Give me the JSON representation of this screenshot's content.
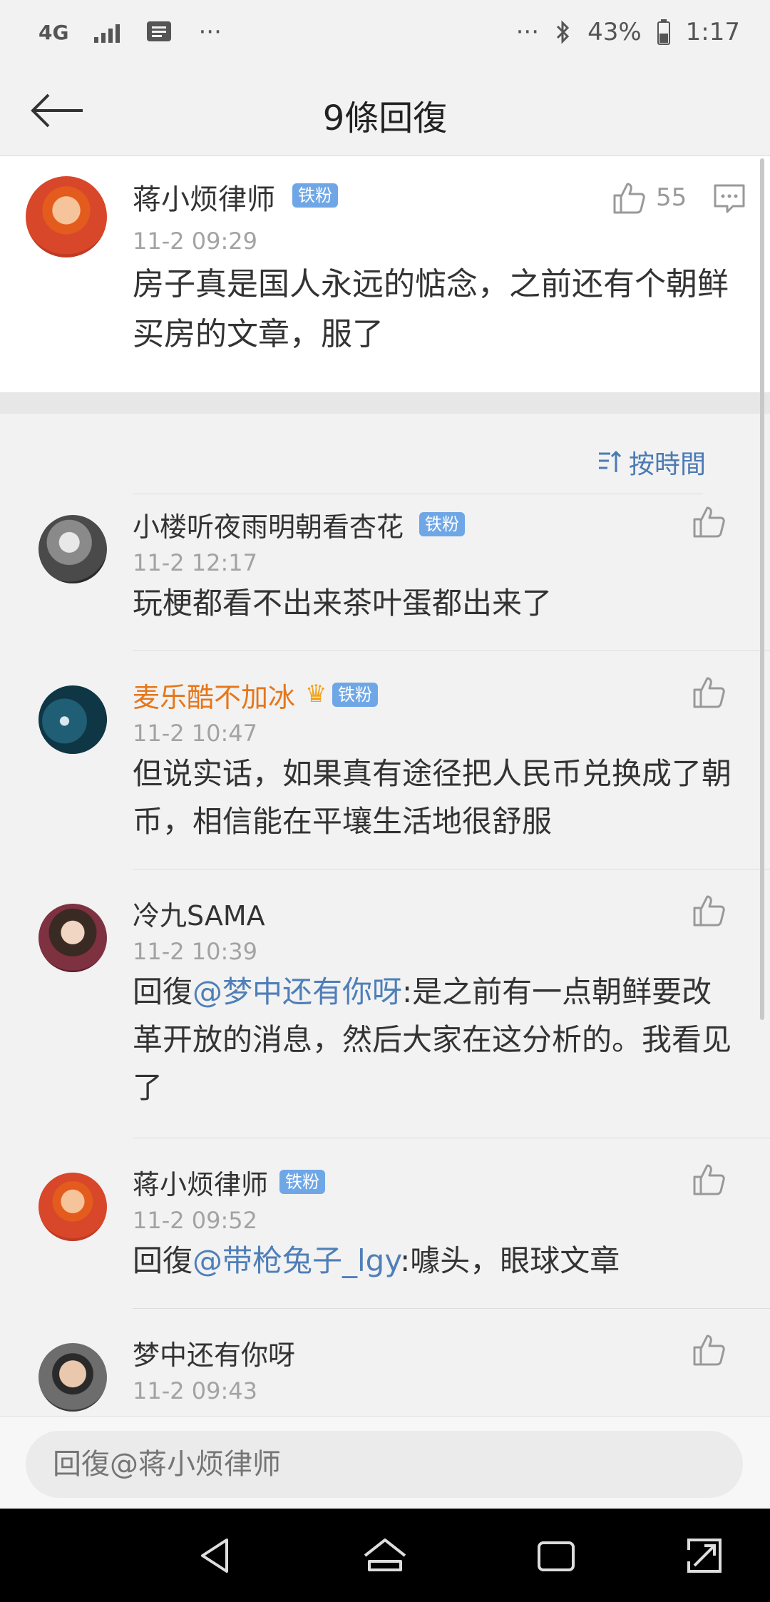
{
  "status_bar": {
    "network": "4G",
    "overflow_left": "···",
    "overflow_right": "···",
    "battery": "43%",
    "time": "1:17"
  },
  "header": {
    "title": "9條回復"
  },
  "main_comment": {
    "username": "蒋小烦律师",
    "badge": "铁粉",
    "time": "11-2 09:29",
    "likes": "55",
    "content": "房子真是国人永远的惦念，之前还有个朝鲜买房的文章，服了"
  },
  "sort": {
    "label": "按時間"
  },
  "replies": [
    {
      "username": "小楼听夜雨明朝看杏花",
      "badge": "铁粉",
      "time": "11-2 12:17",
      "content": "玩梗都看不出来茶叶蛋都出来了"
    },
    {
      "username": "麦乐酷不加冰",
      "badge": "铁粉",
      "time": "11-2 10:47",
      "content": "但说实话，如果真有途径把人民币兑换成了朝币，相信能在平壤生活地很舒服"
    },
    {
      "username": "冷九SAMA",
      "time": "11-2 10:39",
      "prefix": "回復",
      "mention": "@梦中还有你呀",
      "content": ":是之前有一点朝鲜要改革开放的消息，然后大家在这分析的。我看见了"
    },
    {
      "username": "蒋小烦律师",
      "badge": "铁粉",
      "time": "11-2 09:52",
      "prefix": "回復",
      "mention": "@带枪兔子_lgy",
      "content": ":噱头，眼球文章"
    },
    {
      "username": "梦中还有你呀",
      "time": "11-2 09:43"
    }
  ],
  "input": {
    "placeholder": "回復@蒋小烦律师"
  },
  "colors": {
    "link": "#4f7fb8",
    "badge": "#6fa7e6",
    "vip_name": "#e6761a"
  }
}
